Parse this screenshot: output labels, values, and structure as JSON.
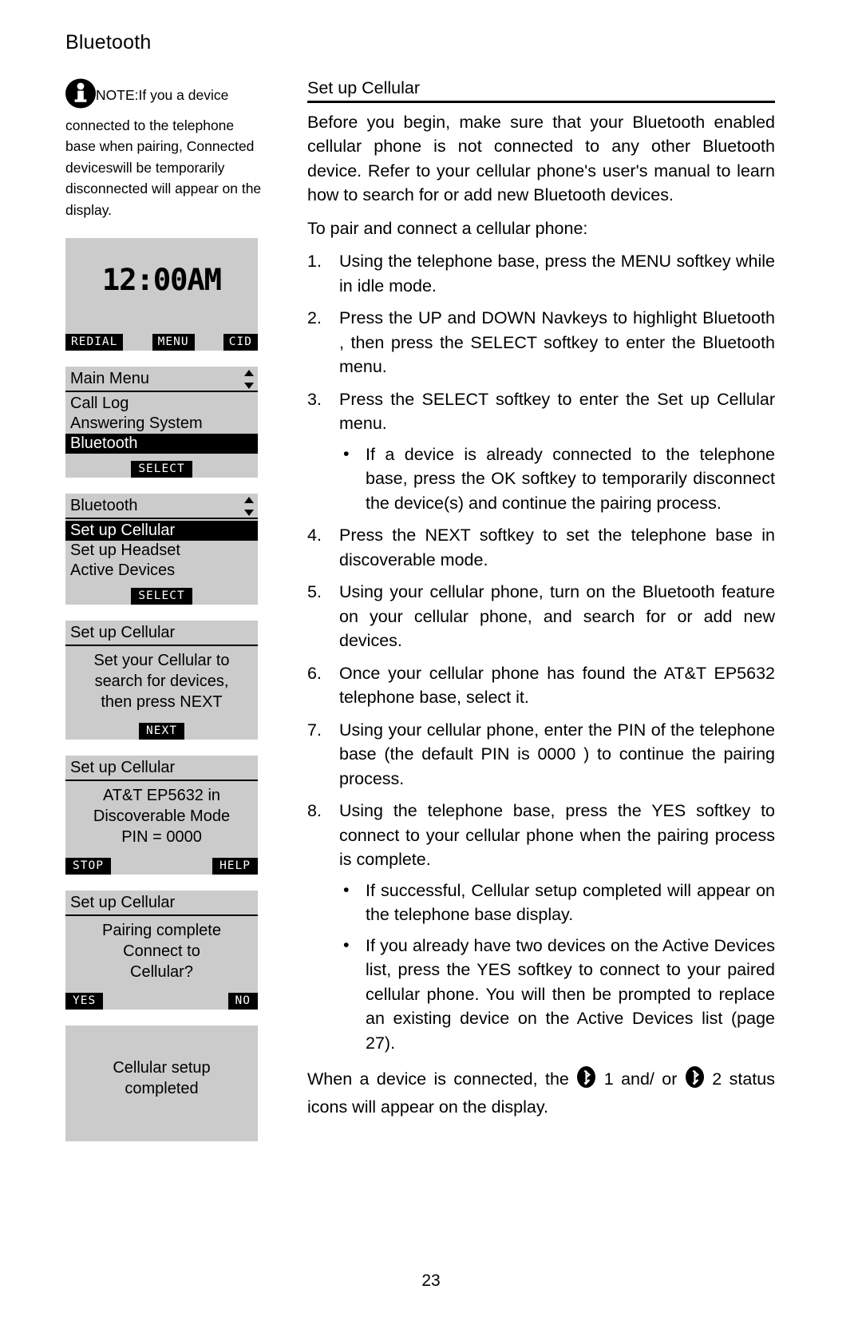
{
  "document": {
    "chapter_title": "Bluetooth",
    "page_number": "23"
  },
  "note": {
    "icon": "info-icon",
    "label": "NOTE:",
    "text": "If you a device connected to the telephone base when pairing, Connected deviceswill be temporarily disconnected will appear on the display."
  },
  "screens": [
    {
      "id": "idle",
      "type": "idle",
      "clock": "12:00AM",
      "softkeys": [
        "REDIAL",
        "MENU",
        "CID"
      ]
    },
    {
      "id": "main-menu",
      "type": "menu",
      "title": "Main Menu",
      "items": [
        "Call Log",
        "Answering System",
        "Bluetooth"
      ],
      "selected_index": 2,
      "softkeys": [
        "SELECT"
      ]
    },
    {
      "id": "bluetooth-menu",
      "type": "menu",
      "title": "Bluetooth",
      "items": [
        "Set up Cellular",
        "Set up Headset",
        "Active Devices"
      ],
      "selected_index": 0,
      "softkeys": [
        "SELECT"
      ]
    },
    {
      "id": "search-prompt",
      "type": "message",
      "title": "Set up Cellular",
      "lines": [
        "Set your Cellular to",
        "search for devices,",
        "then press NEXT"
      ],
      "softkeys": [
        "NEXT"
      ]
    },
    {
      "id": "discoverable",
      "type": "message",
      "title": "Set up Cellular",
      "lines": [
        "AT&T EP5632 in",
        "Discoverable Mode",
        "PIN = 0000"
      ],
      "softkeys": [
        "STOP",
        "HELP"
      ]
    },
    {
      "id": "pairing-complete",
      "type": "message",
      "title": "Set up Cellular",
      "lines": [
        "Pairing complete",
        "Connect to",
        "Cellular?"
      ],
      "softkeys": [
        "YES",
        "NO"
      ]
    },
    {
      "id": "setup-completed",
      "type": "plain",
      "lines": [
        "Cellular setup",
        "completed"
      ]
    }
  ],
  "main": {
    "section_title": "Set up Cellular",
    "intro": "Before you begin, make sure that your Bluetooth enabled cellular phone is not connected to any other Bluetooth device. Refer to your cellular phone's user's manual to learn how to search for or add new Bluetooth devices.",
    "lead_in": "To pair and connect a cellular phone:",
    "steps": [
      {
        "num": "1.",
        "text": "Using the telephone base, press the MENU softkey while in idle mode."
      },
      {
        "num": "2.",
        "text": "Press the UP and DOWN Navkeys to highlight Bluetooth , then press the SELECT softkey to enter the Bluetooth  menu."
      },
      {
        "num": "3.",
        "text": "Press the SELECT softkey to enter the Set up Cellular  menu.",
        "bullets": [
          "If a device is already connected to the telephone base, press the OK softkey to temporarily disconnect the device(s) and continue the pairing process."
        ]
      },
      {
        "num": "4.",
        "text": "Press the NEXT softkey to set the telephone base in discoverable mode."
      },
      {
        "num": "5.",
        "text": "Using your cellular phone, turn on the Bluetooth feature on your cellular phone, and search for or add new devices."
      },
      {
        "num": "6.",
        "text": "Once your cellular phone has found the AT&T EP5632 telephone base, select it."
      },
      {
        "num": "7.",
        "text": "Using your cellular phone, enter the PIN of the telephone base (the default PIN is 0000 ) to continue the pairing process."
      },
      {
        "num": "8.",
        "text": "Using the telephone base, press the YES softkey to connect to your cellular phone when the pairing process is complete.",
        "bullets": [
          "If successful, Cellular setup completed  will appear on the telephone base display.",
          "If you already have two devices on the Active Devices list, press the YES softkey to connect to your paired cellular phone. You will then be prompted to replace an existing device on the Active Devices  list (page 27)."
        ]
      }
    ],
    "closing": {
      "part1": "When a device is connected, the",
      "num1": "1",
      "part2": "and/ or",
      "num2": "2",
      "part3": "status icons will appear on the display.",
      "icon": "bluetooth-icon"
    }
  },
  "colors": {
    "lcd_background": "#cbcbcb",
    "ink": "#000000",
    "paper": "#ffffff"
  }
}
